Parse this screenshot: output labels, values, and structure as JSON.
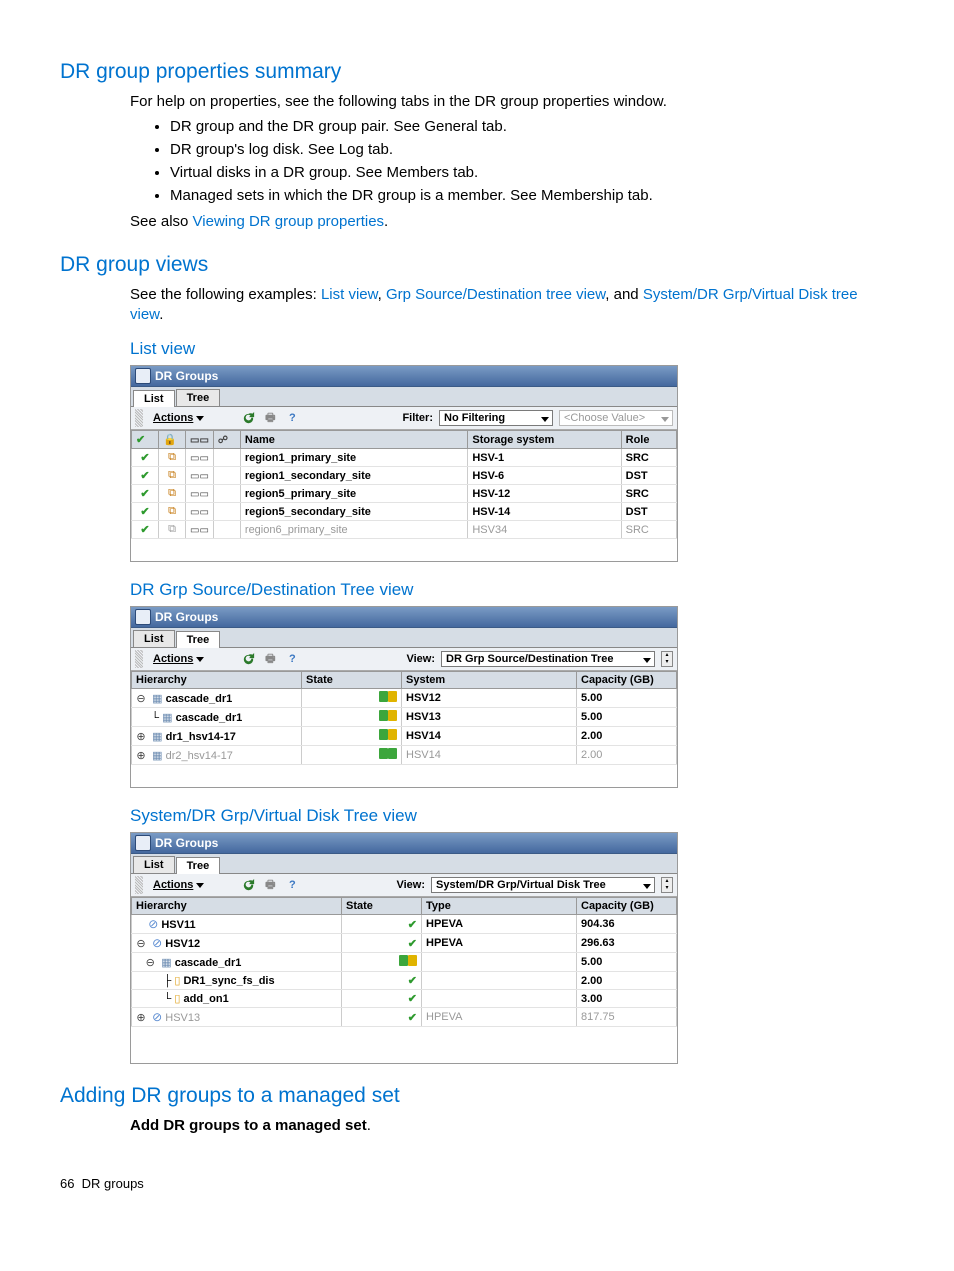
{
  "page": {
    "number": "66",
    "section": "DR groups"
  },
  "h_summary": "DR group properties summary",
  "summary_intro": "For help on properties, see the following tabs in the DR group properties window.",
  "summary_items": [
    "DR group and the DR group pair. See General tab.",
    "DR group's log disk. See Log tab.",
    "Virtual disks in a DR group. See Members tab.",
    "Managed sets in which the DR group is a member. See Membership tab."
  ],
  "see_also_pre": "See also ",
  "see_also_link": "Viewing DR group properties",
  "see_also_post": ".",
  "h_views": "DR group views",
  "views_intro_pre": "See the following examples: ",
  "views_link1": "List view",
  "views_sep1": ", ",
  "views_link2": "Grp Source/Destination tree view",
  "views_sep2": ", and ",
  "views_link3": "System/DR Grp/Virtual Disk tree view",
  "views_post": ".",
  "h_listview": "List view",
  "list_ss": {
    "title": "DR Groups",
    "tabs": [
      "List",
      "Tree"
    ],
    "active_tab": 0,
    "actions": "Actions",
    "filter_label": "Filter:",
    "filter_value": "No Filtering",
    "choose_value": "<Choose Value>",
    "headers": [
      "",
      "",
      "",
      "",
      "Name",
      "Storage system",
      "Role"
    ],
    "rows": [
      {
        "name": "region1_primary_site",
        "system": "HSV-1",
        "role": "SRC"
      },
      {
        "name": "region1_secondary_site",
        "system": "HSV-6",
        "role": "DST"
      },
      {
        "name": "region5_primary_site",
        "system": "HSV-12",
        "role": "SRC"
      },
      {
        "name": "region5_secondary_site",
        "system": "HSV-14",
        "role": "DST"
      }
    ],
    "partial": {
      "name": "region6_primary_site",
      "system": "HSV34",
      "role": "SRC"
    }
  },
  "h_srcdest": "DR Grp Source/Destination Tree view",
  "srcdest_ss": {
    "title": "DR Groups",
    "tabs": [
      "List",
      "Tree"
    ],
    "active_tab": 1,
    "actions": "Actions",
    "view_label": "View:",
    "view_value": "DR Grp Source/Destination Tree",
    "headers": [
      "Hierarchy",
      "State",
      "System",
      "Capacity (GB)"
    ],
    "rows": [
      {
        "indent": 0,
        "name": "cascade_dr1",
        "state": "gy",
        "system": "HSV12",
        "cap": "5.00",
        "expand": "open"
      },
      {
        "indent": 1,
        "name": "cascade_dr1",
        "state": "gy",
        "system": "HSV13",
        "cap": "5.00",
        "expand": "leaf"
      },
      {
        "indent": 0,
        "name": "dr1_hsv14-17",
        "state": "gy",
        "system": "HSV14",
        "cap": "2.00",
        "expand": "closed"
      }
    ],
    "partial": {
      "indent": 0,
      "name": "dr2_hsv14-17",
      "state": "gg",
      "system": "HSV14",
      "cap": "2.00",
      "expand": "closed"
    }
  },
  "h_sysvd": "System/DR Grp/Virtual Disk Tree view",
  "sysvd_ss": {
    "title": "DR Groups",
    "tabs": [
      "List",
      "Tree"
    ],
    "active_tab": 1,
    "actions": "Actions",
    "view_label": "View:",
    "view_value": "System/DR Grp/Virtual Disk Tree",
    "headers": [
      "Hierarchy",
      "State",
      "Type",
      "Capacity (GB)"
    ],
    "rows": [
      {
        "indent": 0,
        "icon": "disk",
        "name": "HSV11",
        "state": "check",
        "type": "HPEVA",
        "cap": "904.36",
        "expand": "none"
      },
      {
        "indent": 0,
        "icon": "disk",
        "name": "HSV12",
        "state": "check",
        "type": "HPEVA",
        "cap": "296.63",
        "expand": "open"
      },
      {
        "indent": 1,
        "icon": "cascade",
        "name": "cascade_dr1",
        "state": "gy",
        "type": "",
        "cap": "5.00",
        "expand": "open"
      },
      {
        "indent": 2,
        "icon": "vd",
        "name": "DR1_sync_fs_dis",
        "state": "check",
        "type": "",
        "cap": "2.00",
        "expand": "leaf"
      },
      {
        "indent": 2,
        "icon": "vd",
        "name": "add_on1",
        "state": "check",
        "type": "",
        "cap": "3.00",
        "expand": "leaf"
      }
    ],
    "partial": {
      "indent": 0,
      "icon": "disk",
      "name": "HSV13",
      "state": "check",
      "type": "HPEVA",
      "cap": "817.75",
      "expand": "closed"
    }
  },
  "h_adding": "Adding DR groups to a managed set",
  "adding_body": "Add DR groups to a managed set"
}
